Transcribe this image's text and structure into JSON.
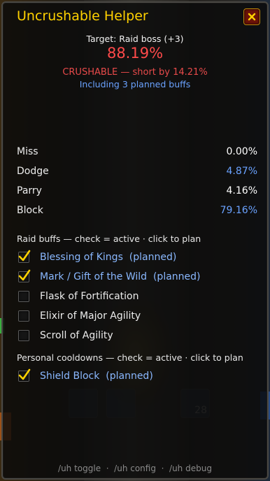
{
  "window": {
    "title": "Uncrushable Helper",
    "close_icon": "close-icon"
  },
  "summary": {
    "target": "Target: Raid boss (+3)",
    "percent": "88.19%",
    "status": "CRUSHABLE — short by 14.21%",
    "note": "Including 3 planned buffs"
  },
  "stats": [
    {
      "label": "Miss",
      "value": "0.00%"
    },
    {
      "label": "Dodge",
      "value": "4.87%"
    },
    {
      "label": "Parry",
      "value": "4.16%"
    },
    {
      "label": "Block",
      "value": "79.16%"
    }
  ],
  "raid_buffs": {
    "header": "Raid buffs — check = active · click to plan",
    "items": [
      {
        "label": "Blessing of Kings  (planned)",
        "checked": true
      },
      {
        "label": "Mark / Gift of the Wild  (planned)",
        "checked": true
      },
      {
        "label": "Flask of Fortification",
        "checked": false
      },
      {
        "label": "Elixir of Major Agility",
        "checked": false
      },
      {
        "label": "Scroll of Agility",
        "checked": false
      }
    ]
  },
  "cooldowns": {
    "header": "Personal cooldowns — check = active · click to plan",
    "items": [
      {
        "label": "Shield Block  (planned)",
        "checked": true
      }
    ]
  },
  "footer": "/uh toggle  ·  /uh config  ·  /uh debug",
  "colors": {
    "title": "#ffd100",
    "crushable": "#ff4a4a",
    "planned_blue": "#6aa2ff",
    "check_gold": "#ffd100"
  },
  "background": {
    "action_slot_count": "28"
  }
}
